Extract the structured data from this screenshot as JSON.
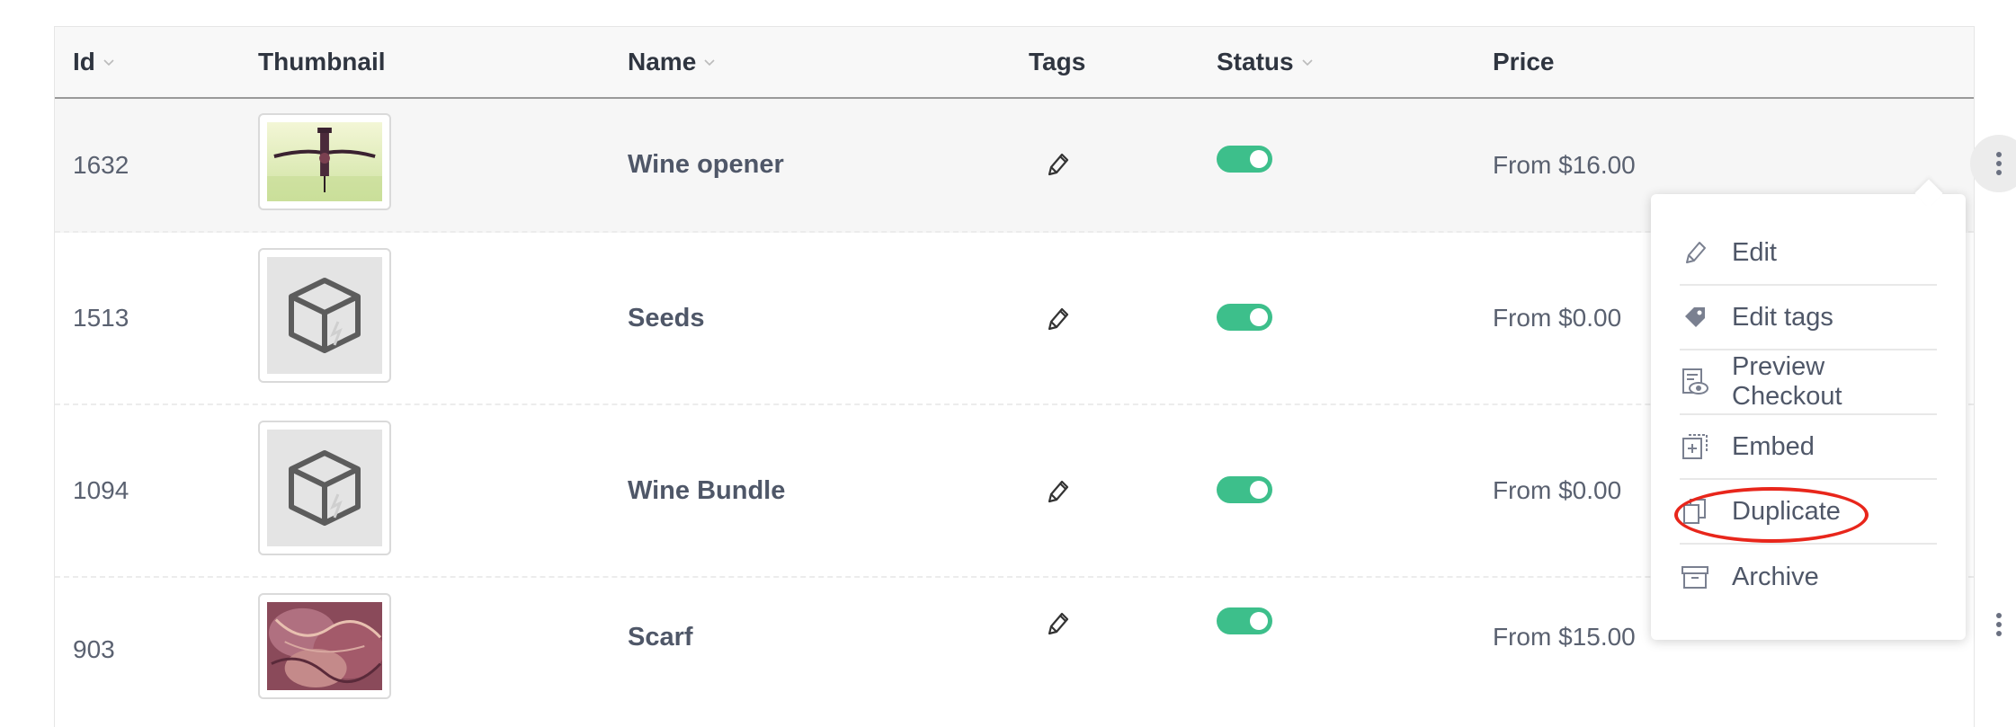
{
  "columns": {
    "id": "Id",
    "thumbnail": "Thumbnail",
    "name": "Name",
    "tags": "Tags",
    "status": "Status",
    "price": "Price"
  },
  "products": [
    {
      "id": "1632",
      "name": "Wine opener",
      "price": "From $16.00",
      "status_enabled": true,
      "thumbnail": "wine-opener-photo"
    },
    {
      "id": "1513",
      "name": "Seeds",
      "price": "From $0.00",
      "status_enabled": true,
      "thumbnail": "placeholder-box"
    },
    {
      "id": "1094",
      "name": "Wine Bundle",
      "price": "From $0.00",
      "status_enabled": true,
      "thumbnail": "placeholder-box"
    },
    {
      "id": "903",
      "name": "Scarf",
      "price": "From $15.00",
      "status_enabled": true,
      "thumbnail": "scarf-photo"
    }
  ],
  "context_menu": {
    "items": [
      {
        "label": "Edit",
        "icon": "pencil-icon"
      },
      {
        "label": "Edit tags",
        "icon": "tag-icon"
      },
      {
        "label": "Preview Checkout",
        "icon": "preview-icon"
      },
      {
        "label": "Embed",
        "icon": "embed-icon"
      },
      {
        "label": "Duplicate",
        "icon": "duplicate-icon"
      },
      {
        "label": "Archive",
        "icon": "archive-icon"
      }
    ],
    "highlighted": "Duplicate"
  },
  "colors": {
    "toggle_on": "#3dbf8b",
    "annotation": "#e8261b"
  }
}
